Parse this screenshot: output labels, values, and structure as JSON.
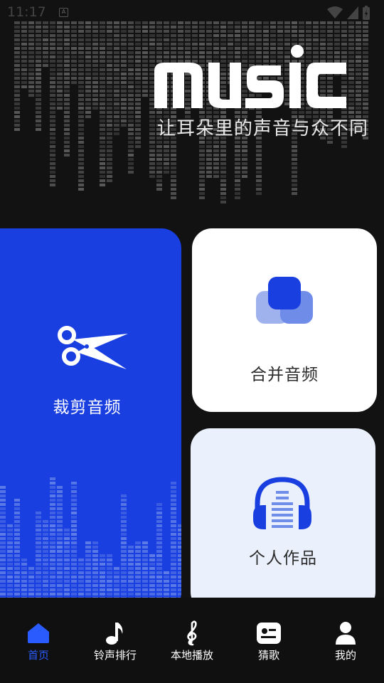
{
  "status_bar": {
    "time": "11:17"
  },
  "hero": {
    "title": "music",
    "subtitle": "让耳朵里的声音与众不同"
  },
  "cards": {
    "cut": {
      "label": "裁剪音频"
    },
    "merge": {
      "label": "合并音频"
    },
    "works": {
      "label": "个人作品"
    }
  },
  "nav": {
    "items": [
      {
        "label": "首页",
        "icon": "home-icon",
        "active": true
      },
      {
        "label": "铃声排行",
        "icon": "music-note-icon",
        "active": false
      },
      {
        "label": "本地播放",
        "icon": "treble-clef-icon",
        "active": false
      },
      {
        "label": "猜歌",
        "icon": "quiz-card-icon",
        "active": false
      },
      {
        "label": "我的",
        "icon": "user-icon",
        "active": false
      }
    ]
  },
  "colors": {
    "accent": "#1a3fe0",
    "active_nav": "#2a5bff",
    "background": "#121212"
  }
}
